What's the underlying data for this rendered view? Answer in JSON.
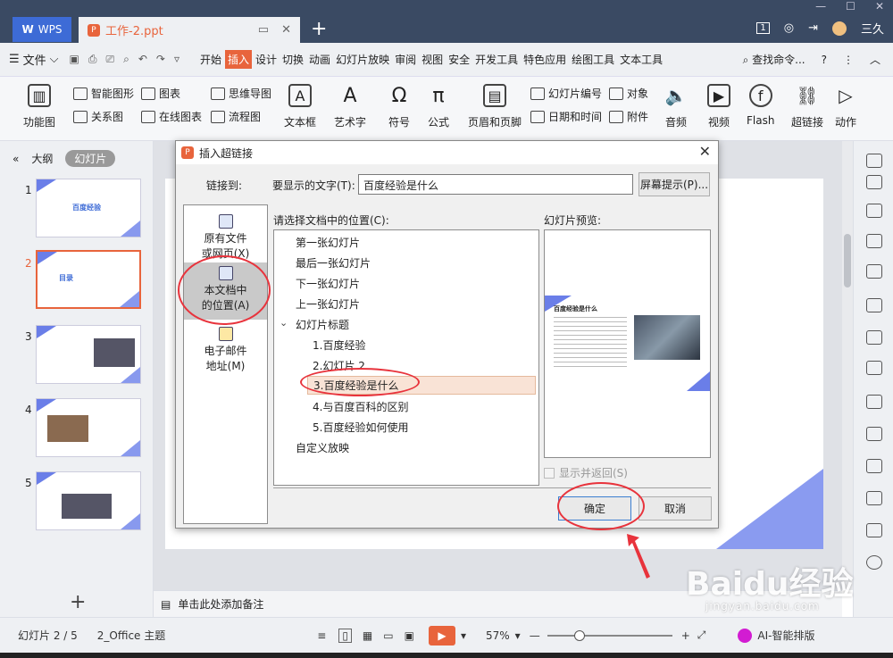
{
  "titlebar": {
    "wps_label": "WPS",
    "doc_tab": "工作-2.ppt",
    "tab_count": "1",
    "user_name": "三久"
  },
  "menubar": {
    "file": "文件",
    "items": [
      "开始",
      "插入",
      "设计",
      "切换",
      "动画",
      "幻灯片放映",
      "审阅",
      "视图",
      "安全",
      "开发工具",
      "特色应用",
      "绘图工具",
      "文本工具"
    ],
    "active": "插入",
    "search": "查找命令...",
    "help": "?"
  },
  "ribbon": {
    "function_chart": "功能图",
    "smart_shape": "智能图形",
    "chart": "图表",
    "mindmap": "思维导图",
    "relation_chart": "关系图",
    "online_chart": "在线图表",
    "flowchart": "流程图",
    "textbox": "文本框",
    "art_text": "艺术字",
    "symbol": "符号",
    "formula": "公式",
    "header_footer": "页眉和页脚",
    "slide_number": "幻灯片编号",
    "object": "对象",
    "date_time": "日期和时间",
    "attachment": "附件",
    "audio": "音频",
    "video": "视频",
    "flash": "Flash",
    "hyperlink": "超链接",
    "action": "动作"
  },
  "left_pane": {
    "tab_outline": "大纲",
    "tab_slides": "幻灯片",
    "thumb1_title": "百度经验",
    "thumb2_title": "目录",
    "thumbs": [
      "1",
      "2",
      "3",
      "4",
      "5"
    ]
  },
  "notes": {
    "placeholder": "单击此处添加备注"
  },
  "statusbar": {
    "slide_pos": "幻灯片 2 / 5",
    "theme": "2_Office 主题",
    "zoom": "57%",
    "ai_label": "AI-智能排版"
  },
  "dialog": {
    "title": "插入超链接",
    "link_to_label": "链接到:",
    "display_text_label": "要显示的文字(T):",
    "display_text_value": "百度经验是什么",
    "screen_tip_button": "屏幕提示(P)...",
    "link_options": [
      {
        "label": "原有文件\n或网页(X)"
      },
      {
        "label": "本文档中\n的位置(A)"
      },
      {
        "label": "电子邮件\n地址(M)"
      }
    ],
    "select_place_label": "请选择文档中的位置(C):",
    "tree": [
      "第一张幻灯片",
      "最后一张幻灯片",
      "下一张幻灯片",
      "上一张幻灯片",
      "幻灯片标题",
      "1.百度经验",
      "2.幻灯片 2",
      "3.百度经验是什么",
      "4.与百度百科的区别",
      "5.百度经验如何使用",
      "自定义放映"
    ],
    "preview_label": "幻灯片预览:",
    "preview_title": "百度经验是什么",
    "show_return_label": "显示并返回(S)",
    "ok_button": "确定",
    "cancel_button": "取消"
  },
  "watermark": {
    "text": "Baidu经验",
    "sub": "jingyan.baidu.com"
  },
  "colors": {
    "accent": "#e8643c",
    "highlight_ring": "#e8333c",
    "titlebar": "#3a4a63"
  }
}
